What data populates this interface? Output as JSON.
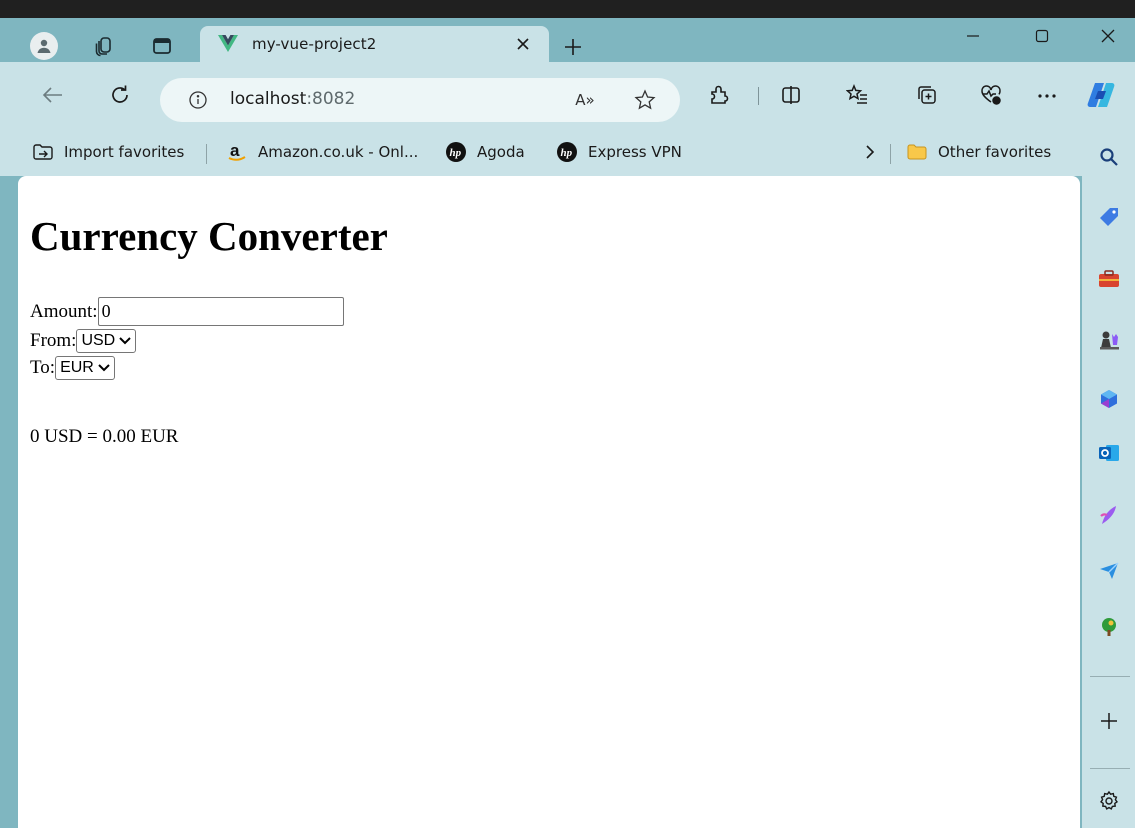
{
  "browser": {
    "tab": {
      "title": "my-vue-project2"
    },
    "address": {
      "host": "localhost",
      "port": ":8082"
    },
    "read_aloud_label": "A»",
    "favorites_bar": {
      "items": [
        {
          "label": "Import favorites"
        },
        {
          "label": "Amazon.co.uk - Onl..."
        },
        {
          "label": "Agoda"
        },
        {
          "label": "Express VPN"
        }
      ],
      "other_label": "Other favorites"
    }
  },
  "page": {
    "heading": "Currency Converter",
    "amount_label": "Amount:",
    "amount_value": "0",
    "from_label": "From:",
    "from_selected": "USD",
    "to_label": "To:",
    "to_selected": "EUR",
    "result": "0 USD = 0.00 EUR"
  }
}
